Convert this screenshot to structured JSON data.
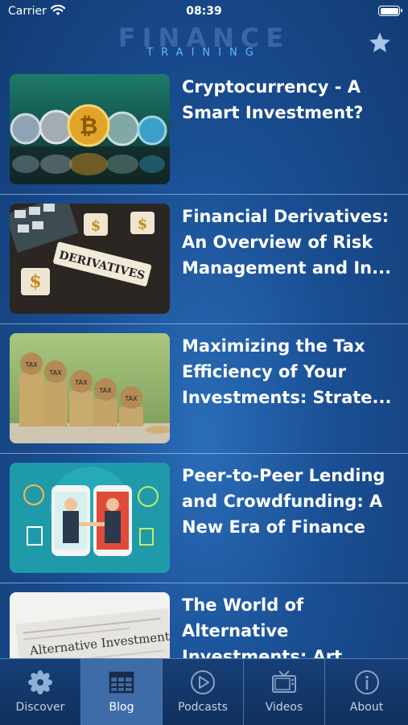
{
  "status_bar": {
    "carrier": "Carrier",
    "time": "08:39"
  },
  "header": {
    "logo_main": "FINANCE",
    "logo_sub": "TRAINING"
  },
  "articles": [
    {
      "title": "Cryptocurrency - A Smart Investment?"
    },
    {
      "title": "Financial Derivatives: An Overview of Risk Management and In..."
    },
    {
      "title": "Maximizing the Tax Efficiency of Your Investments: Strate..."
    },
    {
      "title": "Peer-to-Peer Lending and Crowdfunding: A New Era of Finance"
    },
    {
      "title": "The World of Alternative Investments: Art, Co..."
    }
  ],
  "thumb_text": {
    "derivatives": "DERIVATIVES",
    "dollar": "$",
    "tax": "TAX",
    "bitcoin": "₿",
    "alt_investments": "Alternative Investments"
  },
  "tabs": [
    {
      "label": "Discover",
      "icon": "flower-icon"
    },
    {
      "label": "Blog",
      "icon": "newspaper-icon",
      "active": true
    },
    {
      "label": "Podcasts",
      "icon": "play-circle-icon"
    },
    {
      "label": "Videos",
      "icon": "tv-icon"
    },
    {
      "label": "About",
      "icon": "info-icon"
    }
  ],
  "colors": {
    "background": "#1a4f94",
    "tab_active": "#3e6ca8",
    "logo_sub": "#5fb8ff"
  }
}
